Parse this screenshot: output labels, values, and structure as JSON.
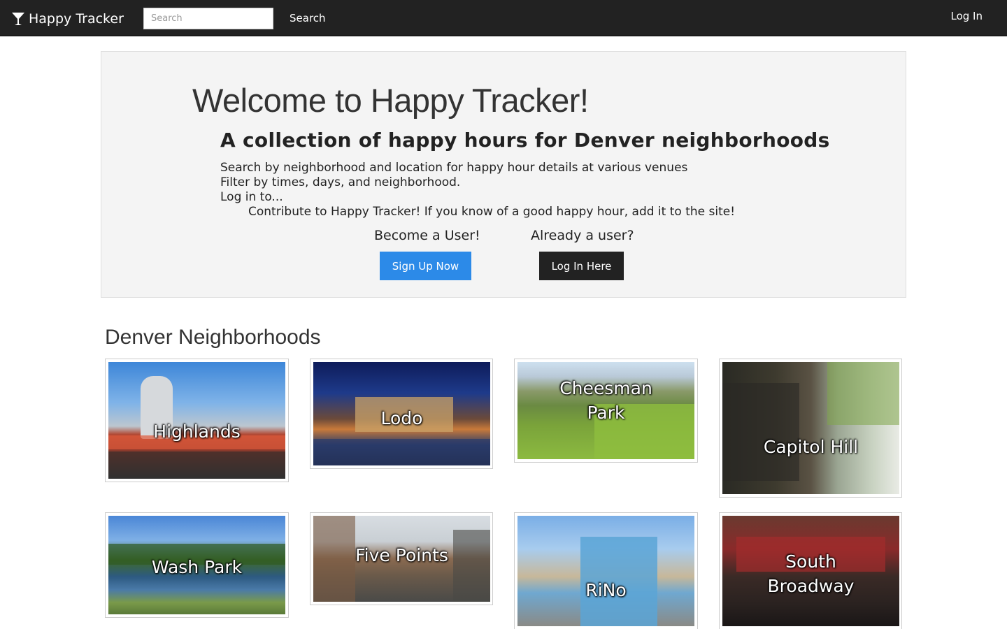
{
  "navbar": {
    "brand": "Happy Tracker",
    "search_placeholder": "Search",
    "search_button": "Search",
    "login_link": "Log In"
  },
  "hero": {
    "welcome": "Welcome to Happy Tracker!",
    "subtitle": "A collection of happy hours for Denver neighborhoods",
    "lines": [
      "Search by neighborhood and location for happy hour details at various venues",
      "Filter by times, days, and neighborhood.",
      "Log in to...",
      "Contribute to Happy Tracker! If you know of a good happy hour, add it to the site!"
    ],
    "signup_prompt": "Become a User!",
    "signup_button": "Sign Up Now",
    "login_prompt": "Already a user?",
    "login_button": "Log In Here"
  },
  "neighborhoods": {
    "title": "Denver Neighborhoods",
    "items": [
      {
        "name": "Highlands"
      },
      {
        "name": "Lodo"
      },
      {
        "name": "Cheesman Park"
      },
      {
        "name": "Capitol Hill"
      },
      {
        "name": "Wash Park"
      },
      {
        "name": "Five Points"
      },
      {
        "name": "RiNo"
      },
      {
        "name": "South Broadway"
      }
    ]
  },
  "colors": {
    "navbar_bg": "#222222",
    "signup_button": "#2c8ae8",
    "login_button": "#222222",
    "jumbotron_bg": "#f4f4f4"
  },
  "icons": {
    "brand_logo": "cocktail-glass-icon"
  }
}
